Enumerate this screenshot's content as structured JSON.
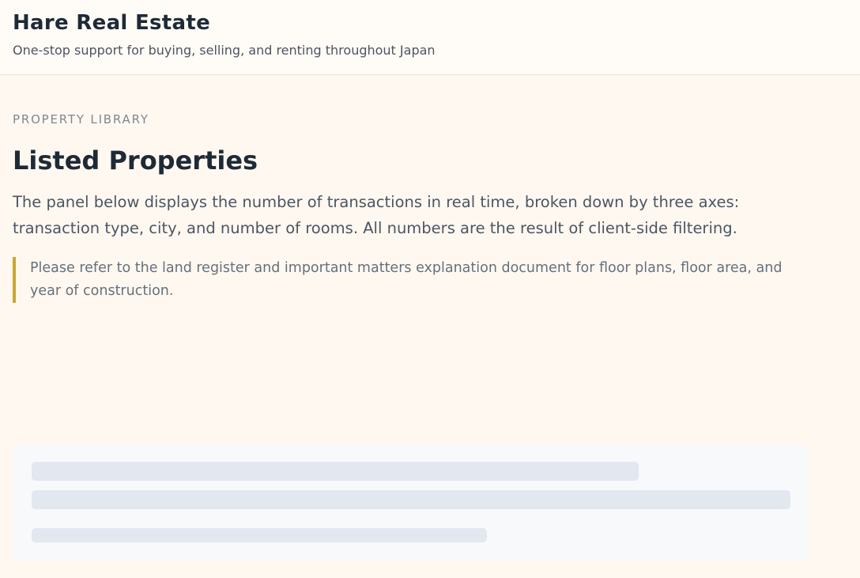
{
  "header": {
    "title": "Hare Real Estate",
    "tagline": "One-stop support for buying, selling, and renting throughout Japan"
  },
  "main": {
    "eyebrow": "PROPERTY LIBRARY",
    "title": "Listed Properties",
    "description": "The panel below displays the number of transactions in real time, broken down by three axes: transaction type, city, and number of rooms. All numbers are the result of client-side filtering.",
    "note": "Please refer to the land register and important matters explanation document for floor plans, floor area, and year of construction."
  },
  "colors": {
    "background": "#fff8f1",
    "accent_border": "#c9a634",
    "skeleton": "#e2e7f0"
  }
}
